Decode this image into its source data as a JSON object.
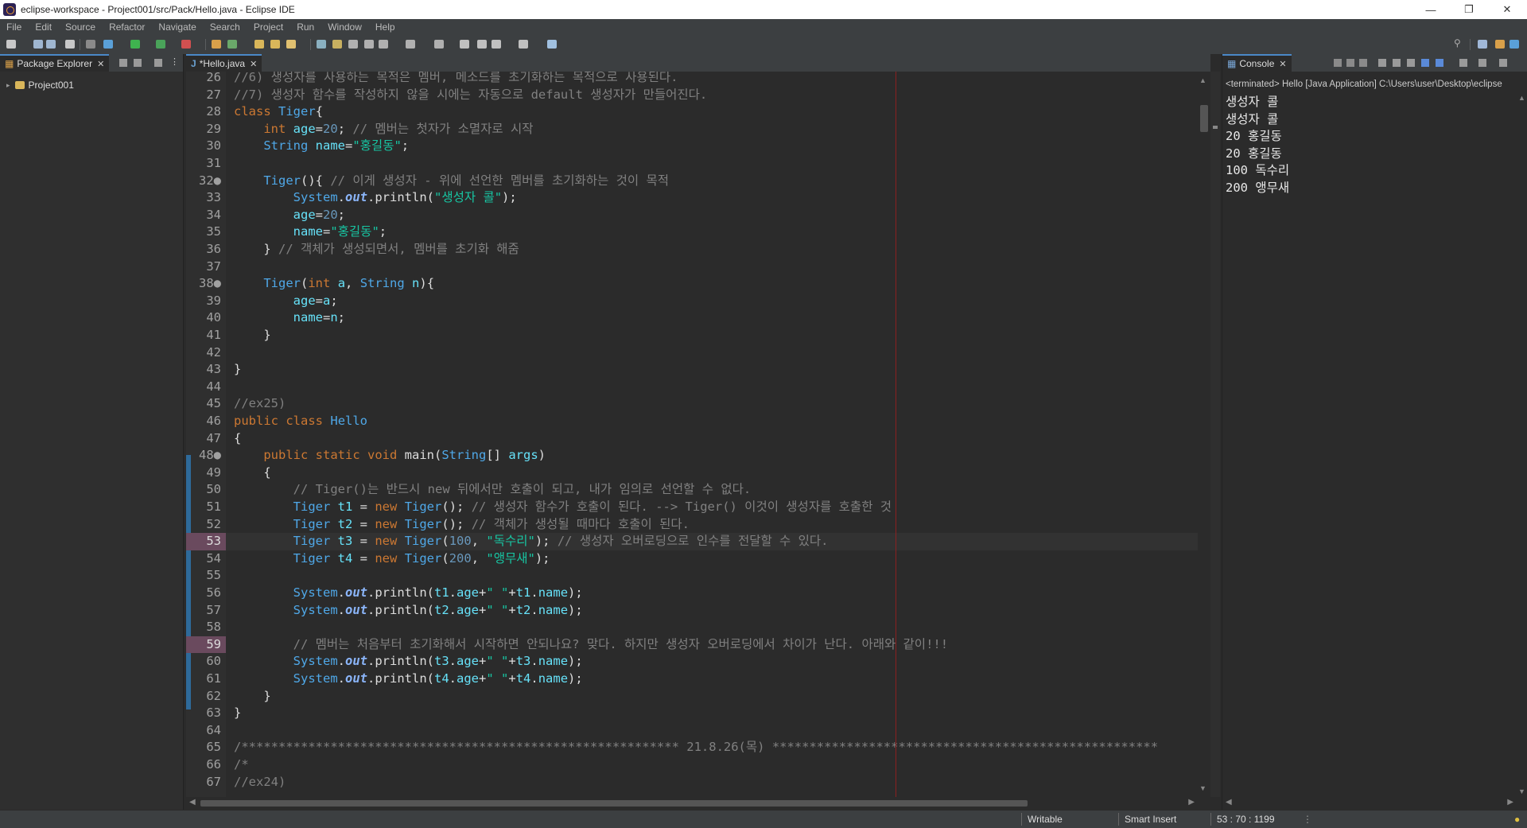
{
  "window": {
    "title": "eclipse-workspace - Project001/src/Pack/Hello.java - Eclipse IDE"
  },
  "menu": [
    "File",
    "Edit",
    "Source",
    "Refactor",
    "Navigate",
    "Search",
    "Project",
    "Run",
    "Window",
    "Help"
  ],
  "package_explorer": {
    "tab_label": "Package Explorer",
    "items": [
      {
        "label": "Project001"
      }
    ]
  },
  "editor": {
    "tab_label": "*Hello.java",
    "current_line": 53,
    "highlighted_lines": [
      53,
      59
    ],
    "lines": [
      {
        "n": "26",
        "text": "//6) 생성자를 사용하는 목적은 멤버, 메소드를 초기화하는 목적으로 사용된다."
      },
      {
        "n": "27",
        "text": "//7) 생성자 함수를 작성하지 않을 시에는 자동으로 default 생성자가 만들어진다."
      },
      {
        "n": "28",
        "text": "class Tiger{"
      },
      {
        "n": "29",
        "text": "    int age=20; // 멤버는 첫자가 소멸자로 시작"
      },
      {
        "n": "30",
        "text": "    String name=\"홍길동\";"
      },
      {
        "n": "31",
        "text": ""
      },
      {
        "n": "32●",
        "text": "    Tiger(){ // 이게 생성자 - 위에 선언한 멤버를 초기화하는 것이 목적"
      },
      {
        "n": "33",
        "text": "        System.out.println(\"생성자 콜\");"
      },
      {
        "n": "34",
        "text": "        age=20;"
      },
      {
        "n": "35",
        "text": "        name=\"홍길동\";"
      },
      {
        "n": "36",
        "text": "    } // 객체가 생성되면서, 멤버를 초기화 해줌"
      },
      {
        "n": "37",
        "text": ""
      },
      {
        "n": "38●",
        "text": "    Tiger(int a, String n){"
      },
      {
        "n": "39",
        "text": "        age=a;"
      },
      {
        "n": "40",
        "text": "        name=n;"
      },
      {
        "n": "41",
        "text": "    }"
      },
      {
        "n": "42",
        "text": ""
      },
      {
        "n": "43",
        "text": "}"
      },
      {
        "n": "44",
        "text": ""
      },
      {
        "n": "45",
        "text": "//ex25)"
      },
      {
        "n": "46",
        "text": "public class Hello"
      },
      {
        "n": "47",
        "text": "{"
      },
      {
        "n": "48●",
        "text": "    public static void main(String[] args)"
      },
      {
        "n": "49",
        "text": "    {"
      },
      {
        "n": "50",
        "text": "        // Tiger()는 반드시 new 뒤에서만 호출이 되고, 내가 임의로 선언할 수 없다."
      },
      {
        "n": "51",
        "text": "        Tiger t1 = new Tiger(); // 생성자 함수가 호출이 된다. --> Tiger() 이것이 생성자를 호출한 것"
      },
      {
        "n": "52",
        "text": "        Tiger t2 = new Tiger(); // 객체가 생성될 때마다 호출이 된다."
      },
      {
        "n": "53",
        "text": "        Tiger t3 = new Tiger(100, \"독수리\"); // 생성자 오버로딩으로 인수를 전달할 수 있다."
      },
      {
        "n": "54",
        "text": "        Tiger t4 = new Tiger(200, \"앵무새\");"
      },
      {
        "n": "55",
        "text": ""
      },
      {
        "n": "56",
        "text": "        System.out.println(t1.age+\" \"+t1.name);"
      },
      {
        "n": "57",
        "text": "        System.out.println(t2.age+\" \"+t2.name);"
      },
      {
        "n": "58",
        "text": ""
      },
      {
        "n": "59",
        "text": "        // 멤버는 처음부터 초기화해서 시작하면 안되나요? 맞다. 하지만 생성자 오버로딩에서 차이가 난다. 아래와 같이!!!"
      },
      {
        "n": "60",
        "text": "        System.out.println(t3.age+\" \"+t3.name);"
      },
      {
        "n": "61",
        "text": "        System.out.println(t4.age+\" \"+t4.name);"
      },
      {
        "n": "62",
        "text": "    }"
      },
      {
        "n": "63",
        "text": "}"
      },
      {
        "n": "64",
        "text": ""
      },
      {
        "n": "65",
        "text": "/*********************************************************** 21.8.26(목) ****************************************************"
      },
      {
        "n": "66",
        "text": "/*"
      },
      {
        "n": "67",
        "text": "//ex24)"
      }
    ]
  },
  "console": {
    "tab_label": "Console",
    "status": "<terminated> Hello [Java Application] C:\\Users\\user\\Desktop\\eclipse",
    "output": [
      "생성자 콜",
      "생성자 콜",
      "20 홍길동",
      "20 홍길동",
      "100 독수리",
      "200 앵무새"
    ]
  },
  "statusbar": {
    "writable": "Writable",
    "insert_mode": "Smart Insert",
    "position": "53 : 70 : 1199"
  }
}
